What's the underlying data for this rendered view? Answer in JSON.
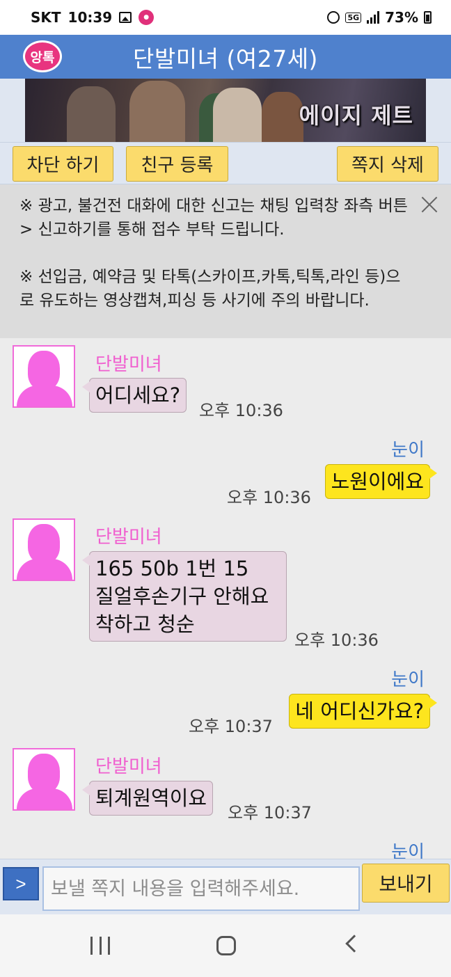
{
  "status_bar": {
    "carrier": "SKT",
    "time": "10:39",
    "network": "5G",
    "battery": "73%"
  },
  "header": {
    "logo_text": "앙톡",
    "title": "단발미녀 (여27세)"
  },
  "banner": {
    "text": "에이지 제트"
  },
  "actions": {
    "block_label": "차단 하기",
    "add_friend_label": "친구 등록",
    "delete_label": "쪽지 삭제"
  },
  "notice": {
    "paragraph1": "※ 광고, 불건전 대화에 대한 신고는 채팅 입력창 좌측 버튼 > 신고하기를 통해 접수 부탁 드립니다.",
    "paragraph2": "※ 선입금, 예약금 및 타톡(스카이프,카톡,틱톡,라인 등)으로 유도하는 영상캡쳐,피싱 등 사기에 주의 바랍니다."
  },
  "chat": {
    "messages": [
      {
        "from": "them",
        "sender": "단발미녀",
        "text": "어디세요?",
        "time": "오후 10:36"
      },
      {
        "from": "me",
        "sender": "눈이",
        "text": "노원이에요",
        "time": "오후 10:36"
      },
      {
        "from": "them",
        "sender": "단발미녀",
        "lines": [
          "165 50b 1번 15",
          "질얼후손기구 안해요",
          "착하고 청순"
        ],
        "time": "오후 10:36"
      },
      {
        "from": "me",
        "sender": "눈이",
        "text": "네 어디신가요?",
        "time": "오후 10:37"
      },
      {
        "from": "them",
        "sender": "단발미녀",
        "text": "퇴계원역이요",
        "time": "오후 10:37"
      },
      {
        "from": "me",
        "sender": "눈이"
      }
    ]
  },
  "input": {
    "placeholder": "보낼 쪽지 내용을 입력해주세요.",
    "send_label": "보내기",
    "menu_icon": ">"
  },
  "colors": {
    "header": "#4f81cd",
    "button": "#fbdb6c",
    "their_bubble": "#e8d6e2",
    "my_bubble": "#fde51e",
    "their_name": "#f05fcf",
    "my_name": "#3f78c8"
  }
}
